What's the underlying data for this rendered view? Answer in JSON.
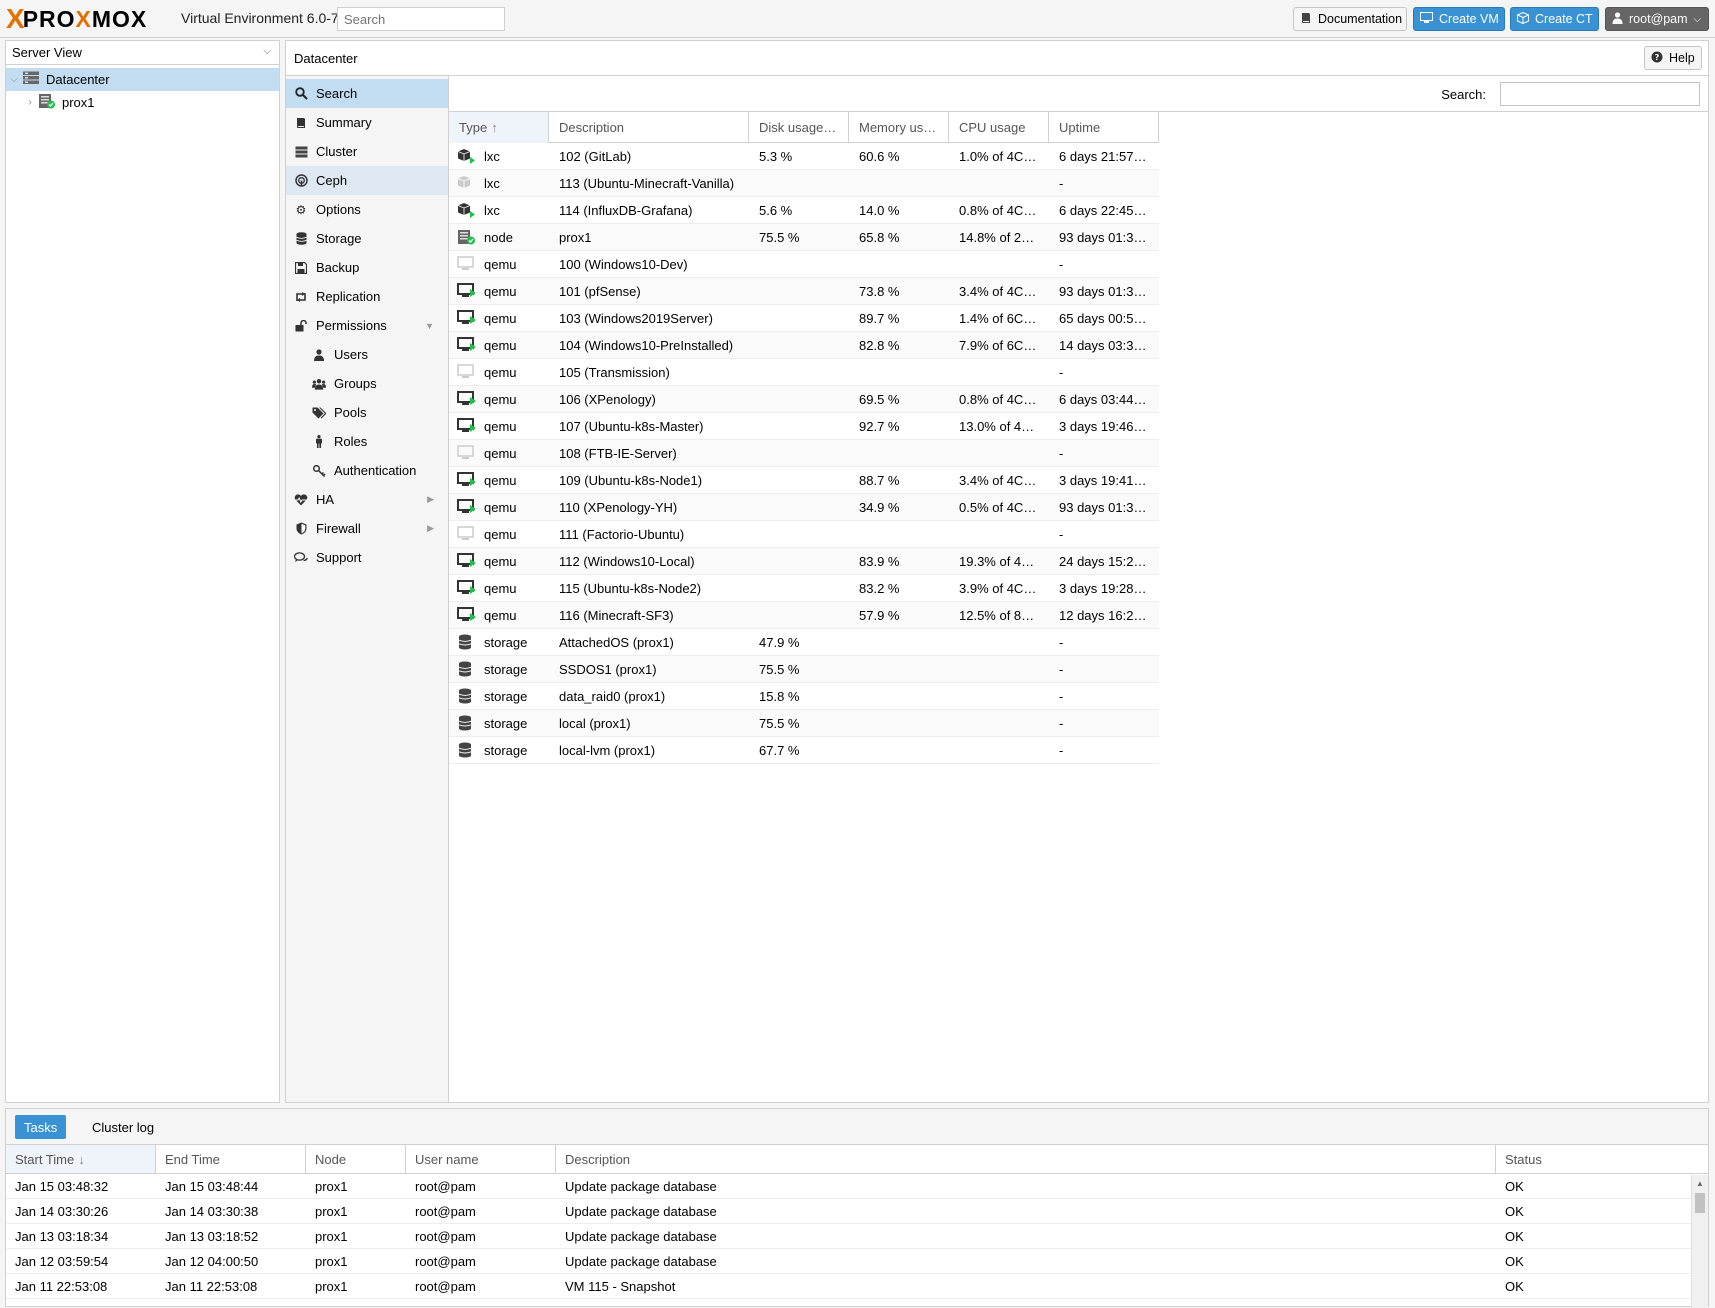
{
  "header": {
    "logo_x": "X",
    "logo_text_a": "PRO",
    "logo_text_x": "X",
    "logo_text_b": "MOX",
    "version": "Virtual Environment 6.0-7",
    "search_placeholder": "Search",
    "buttons": {
      "documentation": "Documentation",
      "create_vm": "Create VM",
      "create_ct": "Create CT",
      "user": "root@pam"
    }
  },
  "tree": {
    "view": "Server View",
    "items": [
      {
        "label": "Datacenter"
      },
      {
        "label": "prox1"
      }
    ]
  },
  "main": {
    "title": "Datacenter",
    "help": "Help",
    "search_label": "Search:"
  },
  "nav": [
    {
      "label": "Search",
      "icon": "search-icon"
    },
    {
      "label": "Summary",
      "icon": "book-icon"
    },
    {
      "label": "Cluster",
      "icon": "server-icon"
    },
    {
      "label": "Ceph",
      "icon": "ceph-icon"
    },
    {
      "label": "Options",
      "icon": "gear-icon"
    },
    {
      "label": "Storage",
      "icon": "database-icon"
    },
    {
      "label": "Backup",
      "icon": "floppy-icon"
    },
    {
      "label": "Replication",
      "icon": "retweet-icon"
    },
    {
      "label": "Permissions",
      "icon": "unlock-icon"
    },
    {
      "label": "Users",
      "icon": "user-icon"
    },
    {
      "label": "Groups",
      "icon": "users-icon"
    },
    {
      "label": "Pools",
      "icon": "tags-icon"
    },
    {
      "label": "Roles",
      "icon": "male-icon"
    },
    {
      "label": "Authentication",
      "icon": "key-icon"
    },
    {
      "label": "HA",
      "icon": "heartbeat-icon"
    },
    {
      "label": "Firewall",
      "icon": "shield-icon"
    },
    {
      "label": "Support",
      "icon": "comments-icon"
    }
  ],
  "resources": {
    "columns": [
      "Type",
      "Description",
      "Disk usage…",
      "Memory us…",
      "CPU usage",
      "Uptime"
    ],
    "rows": [
      {
        "type": "lxc",
        "status": "running",
        "desc": "102 (GitLab)",
        "disk": "5.3 %",
        "mem": "60.6 %",
        "cpu": "1.0% of 4C…",
        "uptime": "6 days 21:57…"
      },
      {
        "type": "lxc",
        "status": "stopped",
        "desc": "113 (Ubuntu-Minecraft-Vanilla)",
        "disk": "",
        "mem": "",
        "cpu": "",
        "uptime": "-"
      },
      {
        "type": "lxc",
        "status": "running",
        "desc": "114 (InfluxDB-Grafana)",
        "disk": "5.6 %",
        "mem": "14.0 %",
        "cpu": "0.8% of 4C…",
        "uptime": "6 days 22:45…"
      },
      {
        "type": "node",
        "status": "online",
        "desc": "prox1",
        "disk": "75.5 %",
        "mem": "65.8 %",
        "cpu": "14.8% of 2…",
        "uptime": "93 days 01:3…"
      },
      {
        "type": "qemu",
        "status": "stopped",
        "desc": "100 (Windows10-Dev)",
        "disk": "",
        "mem": "",
        "cpu": "",
        "uptime": "-"
      },
      {
        "type": "qemu",
        "status": "running",
        "desc": "101 (pfSense)",
        "disk": "",
        "mem": "73.8 %",
        "cpu": "3.4% of 4C…",
        "uptime": "93 days 01:3…"
      },
      {
        "type": "qemu",
        "status": "running",
        "desc": "103 (Windows2019Server)",
        "disk": "",
        "mem": "89.7 %",
        "cpu": "1.4% of 6C…",
        "uptime": "65 days 00:5…"
      },
      {
        "type": "qemu",
        "status": "running",
        "desc": "104 (Windows10-PreInstalled)",
        "disk": "",
        "mem": "82.8 %",
        "cpu": "7.9% of 6C…",
        "uptime": "14 days 03:3…"
      },
      {
        "type": "qemu",
        "status": "stopped",
        "desc": "105 (Transmission)",
        "disk": "",
        "mem": "",
        "cpu": "",
        "uptime": "-"
      },
      {
        "type": "qemu",
        "status": "running",
        "desc": "106 (XPenology)",
        "disk": "",
        "mem": "69.5 %",
        "cpu": "0.8% of 4C…",
        "uptime": "6 days 03:44…"
      },
      {
        "type": "qemu",
        "status": "running",
        "desc": "107 (Ubuntu-k8s-Master)",
        "disk": "",
        "mem": "92.7 %",
        "cpu": "13.0% of 4…",
        "uptime": "3 days 19:46…"
      },
      {
        "type": "qemu",
        "status": "stopped",
        "desc": "108 (FTB-IE-Server)",
        "disk": "",
        "mem": "",
        "cpu": "",
        "uptime": "-"
      },
      {
        "type": "qemu",
        "status": "running",
        "desc": "109 (Ubuntu-k8s-Node1)",
        "disk": "",
        "mem": "88.7 %",
        "cpu": "3.4% of 4C…",
        "uptime": "3 days 19:41…"
      },
      {
        "type": "qemu",
        "status": "running",
        "desc": "110 (XPenology-YH)",
        "disk": "",
        "mem": "34.9 %",
        "cpu": "0.5% of 4C…",
        "uptime": "93 days 01:3…"
      },
      {
        "type": "qemu",
        "status": "stopped",
        "desc": "111 (Factorio-Ubuntu)",
        "disk": "",
        "mem": "",
        "cpu": "",
        "uptime": "-"
      },
      {
        "type": "qemu",
        "status": "running",
        "desc": "112 (Windows10-Local)",
        "disk": "",
        "mem": "83.9 %",
        "cpu": "19.3% of 4…",
        "uptime": "24 days 15:2…"
      },
      {
        "type": "qemu",
        "status": "running",
        "desc": "115 (Ubuntu-k8s-Node2)",
        "disk": "",
        "mem": "83.2 %",
        "cpu": "3.9% of 4C…",
        "uptime": "3 days 19:28…"
      },
      {
        "type": "qemu",
        "status": "running",
        "desc": "116 (Minecraft-SF3)",
        "disk": "",
        "mem": "57.9 %",
        "cpu": "12.5% of 8…",
        "uptime": "12 days 16:2…"
      },
      {
        "type": "storage",
        "status": "available",
        "desc": "AttachedOS (prox1)",
        "disk": "47.9 %",
        "mem": "",
        "cpu": "",
        "uptime": "-"
      },
      {
        "type": "storage",
        "status": "available",
        "desc": "SSDOS1 (prox1)",
        "disk": "75.5 %",
        "mem": "",
        "cpu": "",
        "uptime": "-"
      },
      {
        "type": "storage",
        "status": "available",
        "desc": "data_raid0 (prox1)",
        "disk": "15.8 %",
        "mem": "",
        "cpu": "",
        "uptime": "-"
      },
      {
        "type": "storage",
        "status": "available",
        "desc": "local (prox1)",
        "disk": "75.5 %",
        "mem": "",
        "cpu": "",
        "uptime": "-"
      },
      {
        "type": "storage",
        "status": "available",
        "desc": "local-lvm (prox1)",
        "disk": "67.7 %",
        "mem": "",
        "cpu": "",
        "uptime": "-"
      }
    ]
  },
  "bottom": {
    "tabs": [
      "Tasks",
      "Cluster log"
    ],
    "columns": [
      "Start Time",
      "End Time",
      "Node",
      "User name",
      "Description",
      "Status"
    ],
    "rows": [
      {
        "start": "Jan 15 03:48:32",
        "end": "Jan 15 03:48:44",
        "node": "prox1",
        "user": "root@pam",
        "desc": "Update package database",
        "status": "OK"
      },
      {
        "start": "Jan 14 03:30:26",
        "end": "Jan 14 03:30:38",
        "node": "prox1",
        "user": "root@pam",
        "desc": "Update package database",
        "status": "OK"
      },
      {
        "start": "Jan 13 03:18:34",
        "end": "Jan 13 03:18:52",
        "node": "prox1",
        "user": "root@pam",
        "desc": "Update package database",
        "status": "OK"
      },
      {
        "start": "Jan 12 03:59:54",
        "end": "Jan 12 04:00:50",
        "node": "prox1",
        "user": "root@pam",
        "desc": "Update package database",
        "status": "OK"
      },
      {
        "start": "Jan 11 22:53:08",
        "end": "Jan 11 22:53:08",
        "node": "prox1",
        "user": "root@pam",
        "desc": "VM 115 - Snapshot",
        "status": "OK"
      }
    ]
  },
  "colors": {
    "accent": "#3892d4",
    "selection": "#c2ddf2",
    "logo_orange": "#e57000",
    "running_green": "#21bf4b"
  }
}
